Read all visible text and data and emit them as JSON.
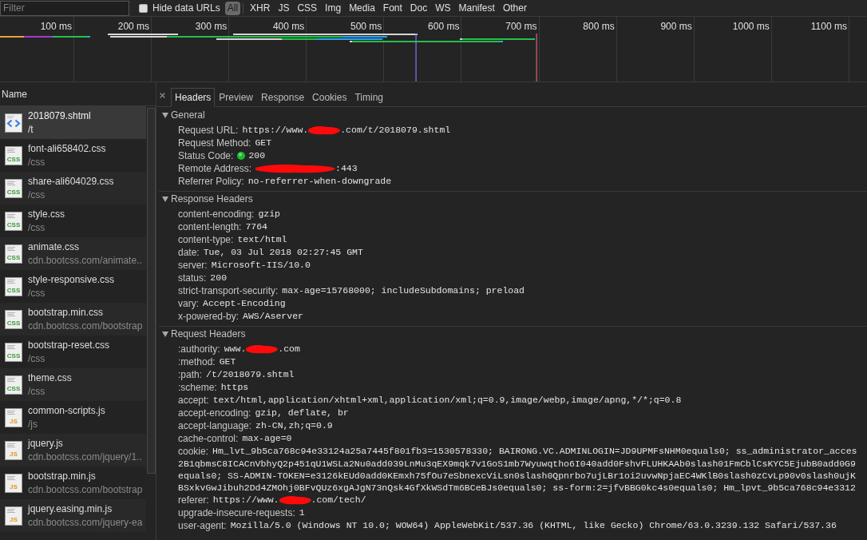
{
  "toolbar": {
    "filter": {
      "placeholder": "Filter"
    },
    "hide_data_urls": {
      "label": "Hide data URLs",
      "checked": false
    },
    "types": [
      {
        "label": "All",
        "selected": true
      },
      {
        "label": "XHR",
        "selected": false
      },
      {
        "label": "JS",
        "selected": false
      },
      {
        "label": "CSS",
        "selected": false
      },
      {
        "label": "Img",
        "selected": false
      },
      {
        "label": "Media",
        "selected": false
      },
      {
        "label": "Font",
        "selected": false
      },
      {
        "label": "Doc",
        "selected": false
      },
      {
        "label": "WS",
        "selected": false
      },
      {
        "label": "Manifest",
        "selected": false
      },
      {
        "label": "Other",
        "selected": false
      }
    ]
  },
  "timeline": {
    "ticks": [
      "100 ms",
      "200 ms",
      "300 ms",
      "400 ms",
      "500 ms",
      "600 ms",
      "700 ms",
      "800 ms",
      "900 ms",
      "1000 ms",
      "1100 ms"
    ]
  },
  "requests": {
    "column": "Name",
    "items": [
      {
        "name": "2018079.shtml",
        "path": "/t",
        "kind": "html",
        "selected": true
      },
      {
        "name": "font-ali658402.css",
        "path": "/css",
        "kind": "css",
        "badge": "CSS",
        "selected": false
      },
      {
        "name": "share-ali604029.css",
        "path": "/css",
        "kind": "css",
        "badge": "CSS",
        "selected": false
      },
      {
        "name": "style.css",
        "path": "/css",
        "kind": "css",
        "badge": "CSS",
        "selected": false
      },
      {
        "name": "animate.css",
        "path": "cdn.bootcss.com/animate..",
        "kind": "css",
        "badge": "CSS",
        "selected": false
      },
      {
        "name": "style-responsive.css",
        "path": "/css",
        "kind": "css",
        "badge": "CSS",
        "selected": false
      },
      {
        "name": "bootstrap.min.css",
        "path": "cdn.bootcss.com/bootstrap",
        "kind": "css",
        "badge": "CSS",
        "selected": false
      },
      {
        "name": "bootstrap-reset.css",
        "path": "/css",
        "kind": "css",
        "badge": "CSS",
        "selected": false
      },
      {
        "name": "theme.css",
        "path": "/css",
        "kind": "css",
        "badge": "CSS",
        "selected": false
      },
      {
        "name": "common-scripts.js",
        "path": "/js",
        "kind": "js",
        "badge": "JS",
        "selected": false
      },
      {
        "name": "jquery.js",
        "path": "cdn.bootcss.com/jquery/1..",
        "kind": "js",
        "badge": "JS",
        "selected": false
      },
      {
        "name": "bootstrap.min.js",
        "path": "cdn.bootcss.com/bootstrap",
        "kind": "js",
        "badge": "JS",
        "selected": false
      },
      {
        "name": "jquery.easing.min.js",
        "path": "cdn.bootcss.com/jquery-ea",
        "kind": "js",
        "badge": "JS",
        "selected": false
      }
    ]
  },
  "details": {
    "tabs": [
      {
        "label": "Headers",
        "selected": true
      },
      {
        "label": "Preview",
        "selected": false
      },
      {
        "label": "Response",
        "selected": false
      },
      {
        "label": "Cookies",
        "selected": false
      },
      {
        "label": "Timing",
        "selected": false
      }
    ],
    "sections": [
      {
        "title": "General",
        "expanded": true,
        "rows": [
          {
            "key": "Request URL:",
            "kind": "redacted",
            "value": "https://www.",
            "value_after": ".com/t/2018079.shtml"
          },
          {
            "key": "Request Method:",
            "kind": "text",
            "value": "GET"
          },
          {
            "key": "Status Code:",
            "kind": "status",
            "value": "200"
          },
          {
            "key": "Remote Address:",
            "kind": "masked",
            "value_after": ":443"
          },
          {
            "key": "Referrer Policy:",
            "kind": "text",
            "value": "no-referrer-when-downgrade"
          }
        ]
      },
      {
        "title": "Response Headers",
        "expanded": true,
        "rows": [
          {
            "key": "content-encoding:",
            "kind": "text",
            "value": "gzip"
          },
          {
            "key": "content-length:",
            "kind": "text",
            "value": "7764"
          },
          {
            "key": "content-type:",
            "kind": "text",
            "value": "text/html"
          },
          {
            "key": "date:",
            "kind": "text",
            "value": "Tue, 03 Jul 2018 02:27:45 GMT"
          },
          {
            "key": "server:",
            "kind": "text",
            "value": "Microsoft-IIS/10.0"
          },
          {
            "key": "status:",
            "kind": "text",
            "value": "200"
          },
          {
            "key": "strict-transport-security:",
            "kind": "text",
            "value": "max-age=15768000; includeSubdomains; preload"
          },
          {
            "key": "vary:",
            "kind": "text",
            "value": "Accept-Encoding"
          },
          {
            "key": "x-powered-by:",
            "kind": "text",
            "value": "AWS/Aserver"
          }
        ]
      },
      {
        "title": "Request Headers",
        "expanded": true,
        "rows": [
          {
            "key": ":authority:",
            "kind": "redacted",
            "value": "www.",
            "value_after": ".com"
          },
          {
            "key": ":method:",
            "kind": "text",
            "value": "GET"
          },
          {
            "key": ":path:",
            "kind": "text",
            "value": "/t/2018079.shtml"
          },
          {
            "key": ":scheme:",
            "kind": "text",
            "value": "https"
          },
          {
            "key": "accept:",
            "kind": "text",
            "value": "text/html,application/xhtml+xml,application/xml;q=0.9,image/webp,image/apng,*/*;q=0.8"
          },
          {
            "key": "accept-encoding:",
            "kind": "text",
            "value": "gzip, deflate, br"
          },
          {
            "key": "accept-language:",
            "kind": "text",
            "value": "zh-CN,zh;q=0.9"
          },
          {
            "key": "cache-control:",
            "kind": "text",
            "value": "max-age=0"
          },
          {
            "key": "cookie:",
            "kind": "wrapped",
            "value": "Hm_lvt_9b5ca768c94e33124a25a7445f801fb3=1530578330; BAIRONG.VC.ADMINLOGIN=JD9UPMFsNHM0equals0; ss_administrator_acces",
            "lines": [
              "2B1qbmsC8ICACnVbhyQ2p451qU1WSLa2Nu0add039LnMu3qEX9mqk7v1GoS1mb7Wyuwqtho6I040add0FshvFLUHKAAb0slash01FmCblCsKYC5EjubB0add0G9",
              "equals0; SS-ADMIN-TOKEN=e3126kEUd0add0KEmxh75fOu7eSbnexcViLsn0slash0Qpnrbo7ujLBr1oi2uvwNpjaEC4WKlB0slash0zCvLp90v0slash0ujK",
              "BSxkvGwJibuh2Dd4ZMOhj0BFvQUz6xgAJgN73nQsk4GfXkWSdTm6BCeBJs0equals0; ss-form:2=jfvBBG0kc4s0equals0; Hm_lpvt_9b5ca768c94e3312"
            ]
          },
          {
            "key": "referer:",
            "kind": "redacted",
            "value": "https://www.",
            "value_after": ".com/tech/"
          },
          {
            "key": "upgrade-insecure-requests:",
            "kind": "text",
            "value": "1"
          },
          {
            "key": "user-agent:",
            "kind": "text",
            "value": "Mozilla/5.0 (Windows NT 10.0; WOW64) AppleWebKit/537.36 (KHTML, like Gecko) Chrome/63.0.3239.132 Safari/537.36"
          }
        ]
      }
    ]
  }
}
